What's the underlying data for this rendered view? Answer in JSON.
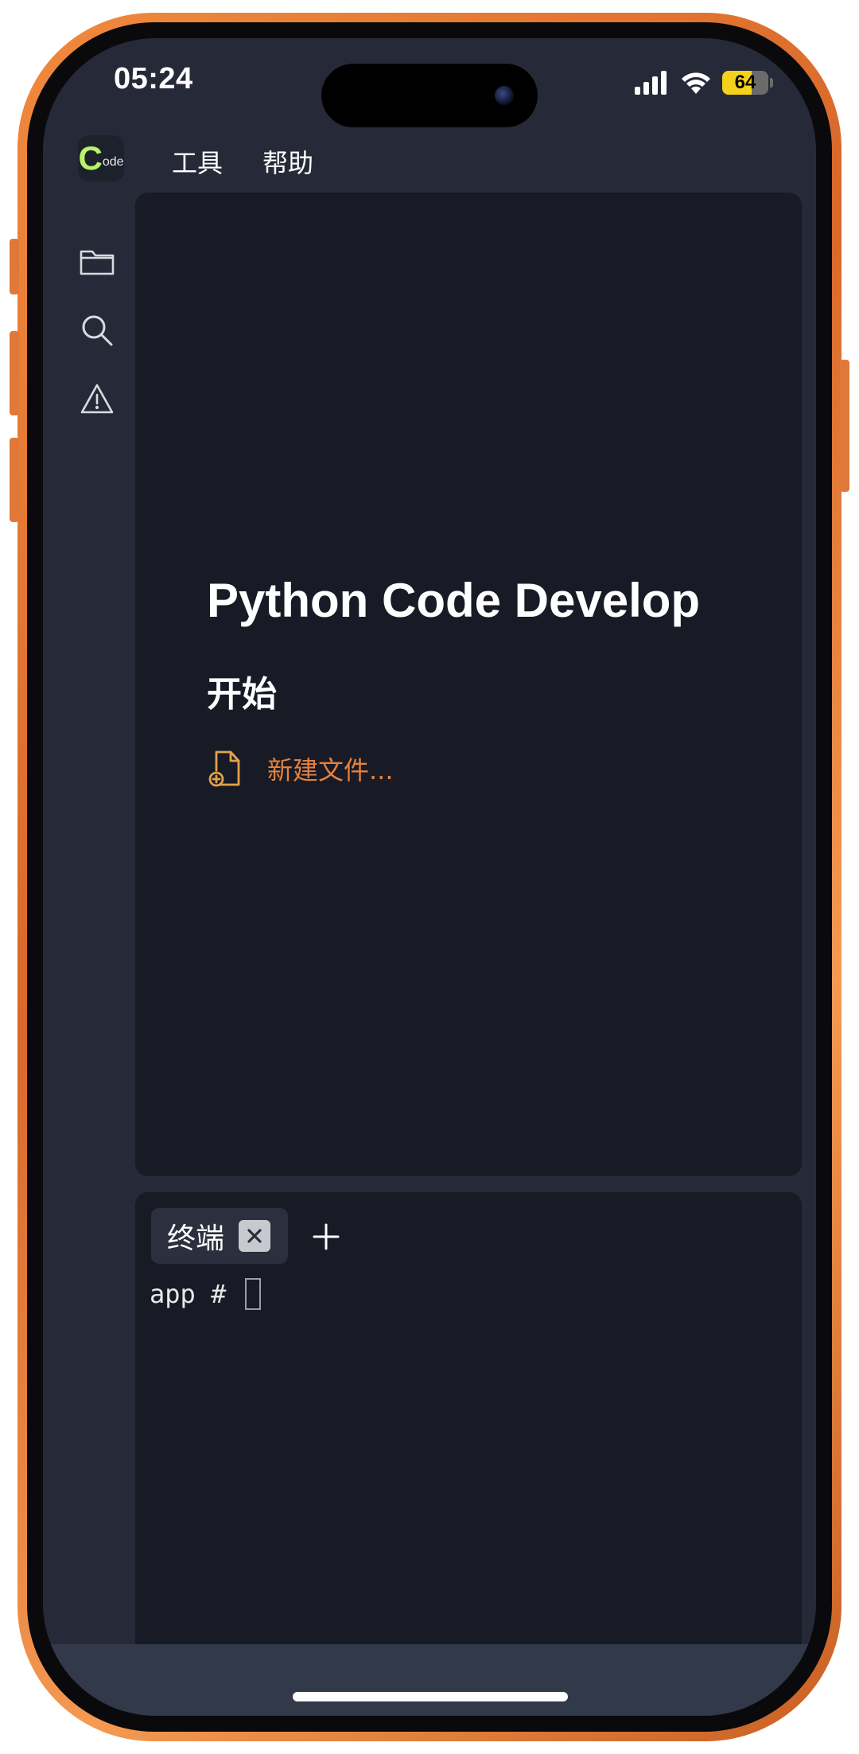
{
  "status_bar": {
    "time": "05:24",
    "battery_level": "64",
    "icons": [
      "signal-icon",
      "wifi-icon",
      "battery-icon"
    ]
  },
  "app": {
    "logo_letter": "C",
    "logo_suffix": "ode"
  },
  "menu": {
    "items": [
      {
        "label": "工具"
      },
      {
        "label": "帮助"
      }
    ]
  },
  "activity_bar": {
    "icons": [
      "folder-icon",
      "search-icon",
      "warning-icon"
    ]
  },
  "welcome": {
    "title": "Python Code Develop",
    "start_heading": "开始",
    "new_file_label": "新建文件..."
  },
  "terminal": {
    "tab_label": "终端",
    "prompt": "app # "
  },
  "colors": {
    "accent": "#e3813e",
    "logo_green": "#b9f36a",
    "battery_yellow": "#f4d21c",
    "frame_orange": "#e0783a"
  }
}
